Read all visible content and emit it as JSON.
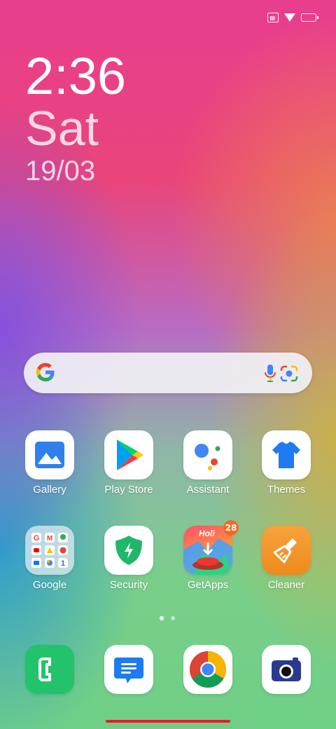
{
  "clock": {
    "time": "2:36",
    "day": "Sat",
    "date": "19/03"
  },
  "search": {
    "google_icon": "google-g-icon",
    "mic_icon": "microphone-icon",
    "lens_icon": "google-lens-icon"
  },
  "apps_row1": [
    {
      "label": "Gallery",
      "icon": "gallery-icon"
    },
    {
      "label": "Play Store",
      "icon": "play-store-icon"
    },
    {
      "label": "Assistant",
      "icon": "assistant-icon"
    },
    {
      "label": "Themes",
      "icon": "themes-icon"
    }
  ],
  "apps_row2": [
    {
      "label": "Google",
      "icon": "google-folder-icon"
    },
    {
      "label": "Security",
      "icon": "security-icon"
    },
    {
      "label": "GetApps",
      "icon": "getapps-icon",
      "badge": "28",
      "banner": "Holi"
    },
    {
      "label": "Cleaner",
      "icon": "cleaner-icon"
    }
  ],
  "dock": [
    {
      "icon": "phone-icon"
    },
    {
      "icon": "messages-icon"
    },
    {
      "icon": "chrome-icon"
    },
    {
      "icon": "camera-icon"
    }
  ],
  "pages": {
    "count": 2,
    "active": 1
  },
  "colors": {
    "badge": "#f26a24",
    "nav_bar": "#e0202a"
  }
}
